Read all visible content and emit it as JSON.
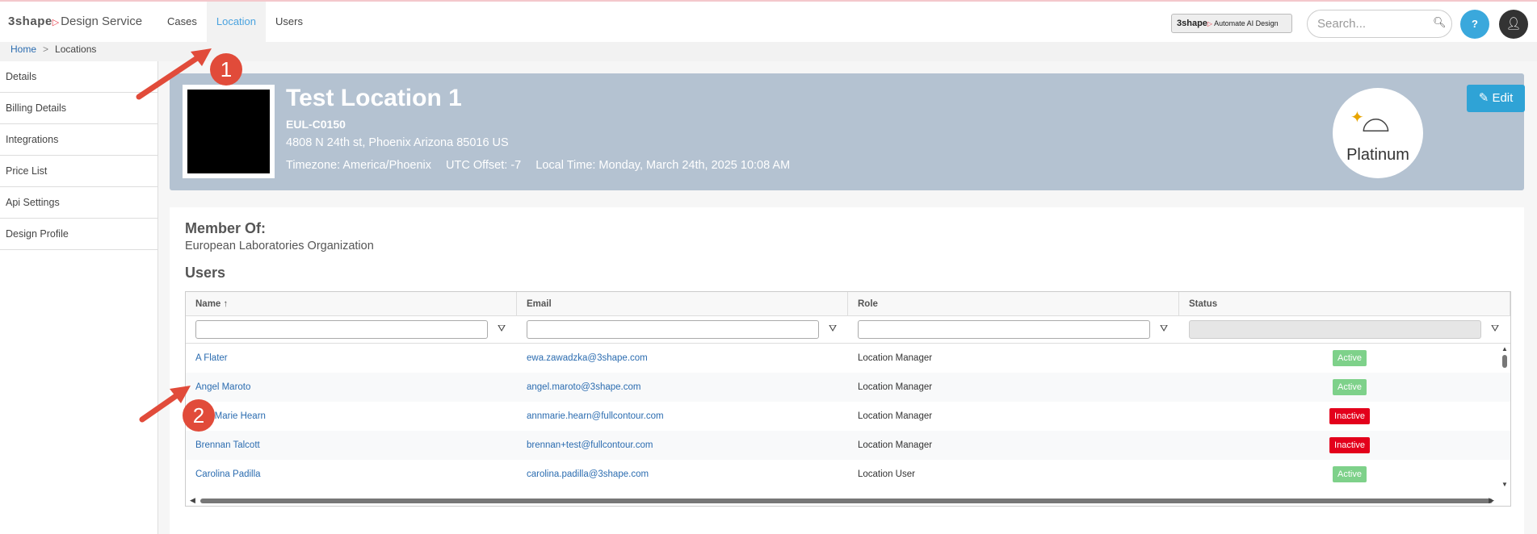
{
  "brand": {
    "logo": "3shape",
    "product": "Design Service"
  },
  "nav": [
    {
      "label": "Cases"
    },
    {
      "label": "Location"
    },
    {
      "label": "Users"
    }
  ],
  "ai_badge": {
    "logo": "3shape",
    "text": "Automate AI Design"
  },
  "search": {
    "placeholder": "Search..."
  },
  "help": {
    "label": "?"
  },
  "breadcrumb": {
    "home": "Home",
    "separator": ">",
    "current": "Locations"
  },
  "sidebar": [
    {
      "label": "Details"
    },
    {
      "label": "Billing Details"
    },
    {
      "label": "Integrations"
    },
    {
      "label": "Price List"
    },
    {
      "label": "Api Settings"
    },
    {
      "label": "Design Profile"
    }
  ],
  "location": {
    "title": "Test Location 1",
    "code": "EUL-C0150",
    "address": "4808 N 24th st, Phoenix Arizona 85016 US",
    "timezone": "Timezone: America/Phoenix",
    "utc_offset": "UTC Offset: -7",
    "local_time": "Local Time: Monday, March 24th, 2025 10:08 AM",
    "tier": "Platinum",
    "edit_label": "Edit"
  },
  "membership": {
    "label": "Member Of:",
    "value": "European Laboratories Organization"
  },
  "users_section": {
    "heading": "Users"
  },
  "grid": {
    "columns": [
      {
        "label": "Name ↑"
      },
      {
        "label": "Email"
      },
      {
        "label": "Role"
      },
      {
        "label": "Status"
      }
    ],
    "rows": [
      {
        "name": "A Flater",
        "email": "ewa.zawadzka@3shape.com",
        "role": "Location Manager",
        "status": "Active"
      },
      {
        "name": "Angel Maroto",
        "email": "angel.maroto@3shape.com",
        "role": "Location Manager",
        "status": "Active"
      },
      {
        "name": "Ann Marie Hearn",
        "email": "annmarie.hearn@fullcontour.com",
        "role": "Location Manager",
        "status": "Inactive"
      },
      {
        "name": "Brennan Talcott",
        "email": "brennan+test@fullcontour.com",
        "role": "Location Manager",
        "status": "Inactive"
      },
      {
        "name": "Carolina Padilla",
        "email": "carolina.padilla@3shape.com",
        "role": "Location User",
        "status": "Active"
      }
    ]
  },
  "annotations": [
    {
      "label": "1"
    },
    {
      "label": "2"
    }
  ],
  "colors": {
    "accent": "#2fa3d6",
    "active": "#7ed18a",
    "inactive": "#e3001b",
    "header_card": "#b4c2d1",
    "annotation": "#e14b3a"
  }
}
